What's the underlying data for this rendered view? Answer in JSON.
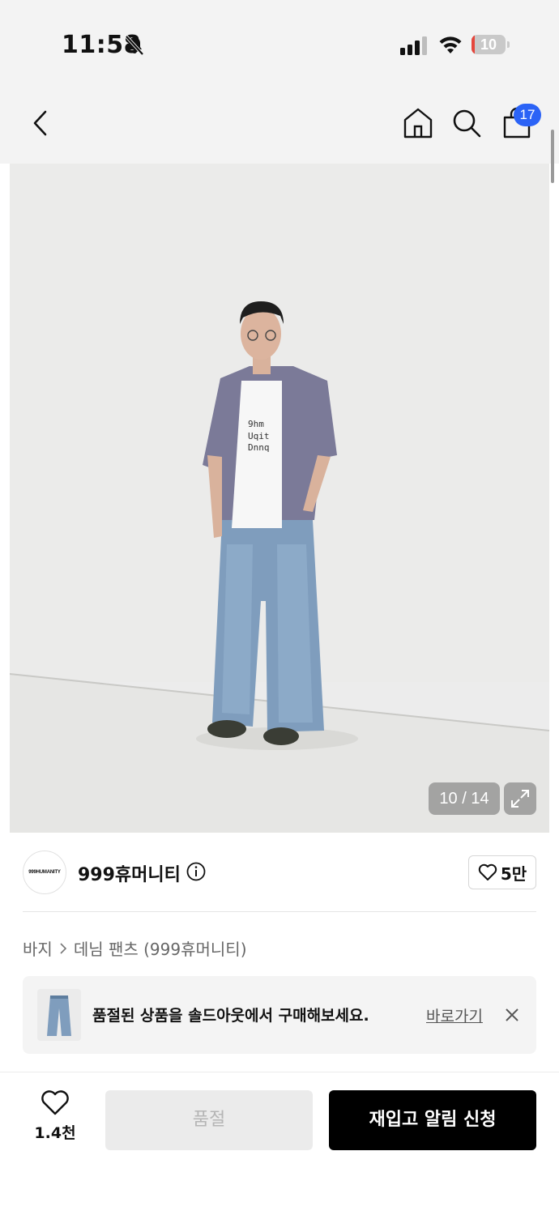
{
  "status_bar": {
    "time": "11:58",
    "battery": "10",
    "battery_level": 0.1,
    "icons": [
      "bell-off-icon",
      "cellular-signal-icon",
      "wifi-icon",
      "battery-icon"
    ]
  },
  "nav": {
    "icons": [
      "back-arrow-icon",
      "home-icon",
      "search-icon",
      "shopping-bag-icon"
    ],
    "cart_count": "17"
  },
  "gallery": {
    "counter": "10 / 14",
    "current": 10,
    "total": 14,
    "icons": [
      "expand-icon"
    ]
  },
  "brand": {
    "logo_text": "999HUMANITY",
    "name": "999휴머니티",
    "likes": "5만",
    "icons": [
      "info-icon",
      "heart-icon"
    ]
  },
  "breadcrumb": {
    "category": "바지",
    "subcategory": "데님 팬츠 (999휴머니티)"
  },
  "soldout_banner": {
    "text": "품절된 상품을 솔드아웃에서 구매해보세요.",
    "link": "바로가기",
    "icons": [
      "jeans-thumbnail",
      "close-icon"
    ]
  },
  "bottom_bar": {
    "wish_count": "1.4천",
    "soldout_label": "품절",
    "restock_label": "재입고 알림 신청"
  },
  "colors": {
    "accent_badge": "#2b63f6",
    "primary_button": "#000000",
    "disabled_button": "#ebebeb",
    "battery_low": "#e5463c"
  }
}
